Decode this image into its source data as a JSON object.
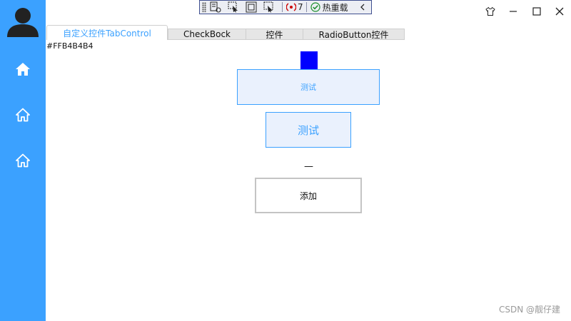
{
  "tabs": [
    {
      "label": "自定义控件TabControl",
      "active": true
    },
    {
      "label": "CheckBock",
      "active": false
    },
    {
      "label": "控件",
      "active": false
    },
    {
      "label": "RadioButton控件",
      "active": false
    }
  ],
  "color_text": "#FFB4B4B4",
  "content": {
    "button1_label": "测试",
    "button2_label": "测试",
    "dash_text": "—",
    "add_button_label": "添加"
  },
  "debug_toolbar": {
    "binding_errors_count": "7",
    "hot_reload_label": "热重载"
  },
  "watermark": "CSDN @靓仔建",
  "colors": {
    "sidebar": "#3ba1ff",
    "accent": "#3ba1ff",
    "square": "#0000ff",
    "button_bg": "#eaf1fd"
  },
  "icons": [
    "avatar-icon",
    "home-filled-icon",
    "home-outline-icon",
    "home-outline-icon-2",
    "shirt-icon",
    "minimize-icon",
    "maximize-icon",
    "close-icon"
  ]
}
